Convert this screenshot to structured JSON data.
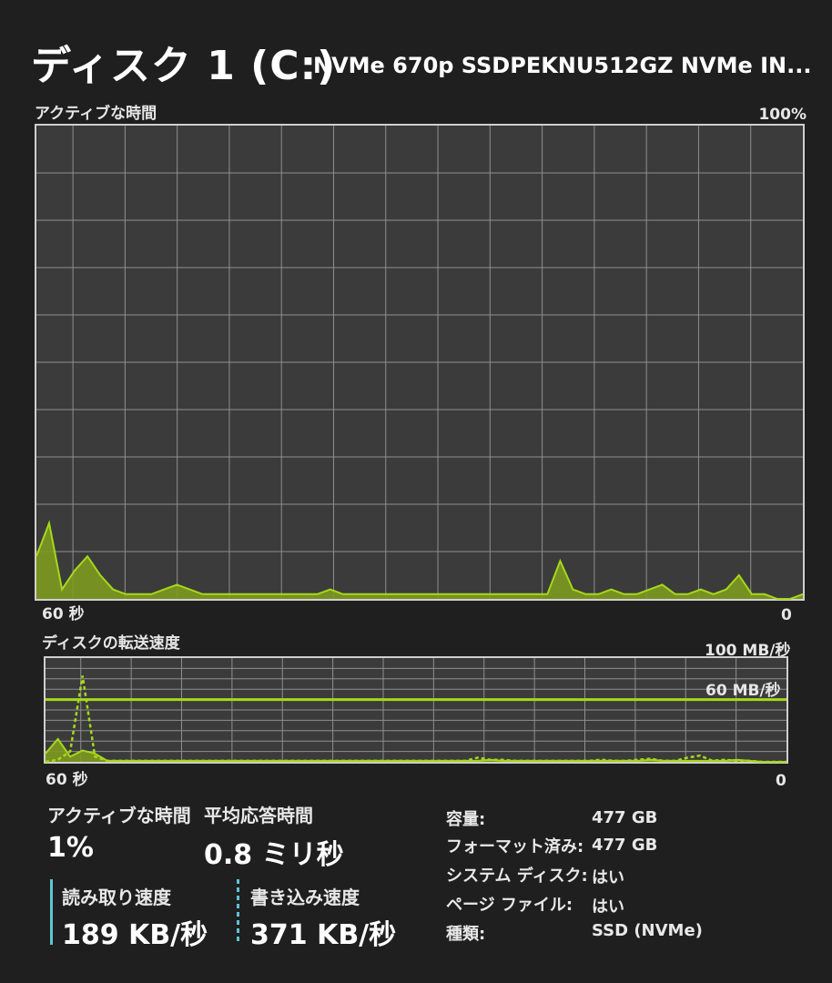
{
  "title": "ディスク 1 (C:)",
  "model": "NVMe 670p SSDPEKNU512GZ NVMe IN...",
  "active_graph": {
    "label": "アクティブな時間",
    "max_label": "100%",
    "left_label": "60 秒",
    "right_label": "0",
    "colors": {
      "line": "#a6d81a",
      "fill": "#7e9a20",
      "grid": "#8f8f8f",
      "border": "#cfcfcf",
      "bg": "#3b3b3b"
    }
  },
  "transfer_graph": {
    "label": "ディスクの転送速度",
    "max_label": "100 MB/秒",
    "ref_label": "60 MB/秒",
    "left_label": "60 秒",
    "right_label": "0"
  },
  "chart_data": [
    {
      "type": "area",
      "title": "アクティブな時間",
      "x": [
        60,
        59,
        58,
        57,
        56,
        55,
        54,
        53,
        52,
        51,
        50,
        49,
        48,
        47,
        46,
        45,
        44,
        43,
        42,
        41,
        40,
        39,
        38,
        37,
        36,
        35,
        34,
        33,
        32,
        31,
        30,
        29,
        28,
        27,
        26,
        25,
        24,
        23,
        22,
        21,
        20,
        19,
        18,
        17,
        16,
        15,
        14,
        13,
        12,
        11,
        10,
        9,
        8,
        7,
        6,
        5,
        4,
        3,
        2,
        1,
        0
      ],
      "series": [
        {
          "values": [
            9,
            16,
            2,
            6,
            9,
            5,
            2,
            1,
            1,
            1,
            2,
            3,
            2,
            1,
            1,
            1,
            1,
            1,
            1,
            1,
            1,
            1,
            1,
            2,
            1,
            1,
            1,
            1,
            1,
            1,
            1,
            1,
            1,
            1,
            1,
            1,
            1,
            1,
            1,
            1,
            1,
            8,
            2,
            1,
            1,
            2,
            1,
            1,
            2,
            3,
            1,
            1,
            2,
            1,
            2,
            5,
            1,
            1,
            0,
            0,
            1
          ]
        }
      ],
      "ylim": [
        0,
        100
      ],
      "xlim": [
        60,
        0
      ]
    },
    {
      "type": "line",
      "title": "ディスクの転送速度",
      "x": [
        60,
        59,
        58,
        57,
        56,
        55,
        54,
        53,
        52,
        51,
        50,
        49,
        48,
        47,
        46,
        45,
        44,
        43,
        42,
        41,
        40,
        39,
        38,
        37,
        36,
        35,
        34,
        33,
        32,
        31,
        30,
        29,
        28,
        27,
        26,
        25,
        24,
        23,
        22,
        21,
        20,
        19,
        18,
        17,
        16,
        15,
        14,
        13,
        12,
        11,
        10,
        9,
        8,
        7,
        6,
        5,
        4,
        3,
        2,
        1,
        0
      ],
      "series": [
        {
          "values": [
            8,
            22,
            5,
            11,
            8,
            1,
            1,
            1,
            1,
            1,
            1,
            1,
            1,
            1,
            1,
            1,
            1,
            1,
            1,
            1,
            1,
            1,
            1,
            1,
            1,
            1,
            1,
            1,
            1,
            1,
            1,
            1,
            1,
            1,
            1,
            1,
            2,
            1,
            1,
            1,
            1,
            1,
            1,
            1,
            1,
            1,
            1,
            1,
            1,
            2,
            1,
            1,
            1,
            1,
            1,
            1,
            2,
            1,
            0,
            0,
            0
          ]
        },
        {
          "values": [
            0,
            2,
            10,
            83,
            5,
            1,
            1,
            1,
            1,
            1,
            1,
            1,
            1,
            1,
            1,
            1,
            1,
            1,
            1,
            1,
            1,
            1,
            1,
            1,
            1,
            1,
            1,
            1,
            1,
            1,
            1,
            1,
            1,
            1,
            1,
            4,
            2,
            2,
            1,
            1,
            1,
            1,
            1,
            1,
            1,
            2,
            1,
            1,
            2,
            3,
            1,
            1,
            4,
            6,
            1,
            2,
            1,
            1,
            0,
            0,
            0
          ]
        }
      ],
      "ylim": [
        0,
        100
      ],
      "reference_line": 60,
      "xlim": [
        60,
        0
      ]
    }
  ],
  "stats": {
    "active_time": {
      "label": "アクティブな時間",
      "value": "1%"
    },
    "avg_response": {
      "label": "平均応答時間",
      "value": "0.8 ミリ秒"
    },
    "read_speed": {
      "label": "読み取り速度",
      "value": "189 KB/秒"
    },
    "write_speed": {
      "label": "書き込み速度",
      "value": "371 KB/秒"
    }
  },
  "info": [
    {
      "label": "容量:",
      "value": "477 GB"
    },
    {
      "label": "フォーマット済み:",
      "value": "477 GB"
    },
    {
      "label": "システム ディスク:",
      "value": "はい"
    },
    {
      "label": "ページ ファイル:",
      "value": "はい"
    },
    {
      "label": "種類:",
      "value": "SSD (NVMe)"
    }
  ]
}
